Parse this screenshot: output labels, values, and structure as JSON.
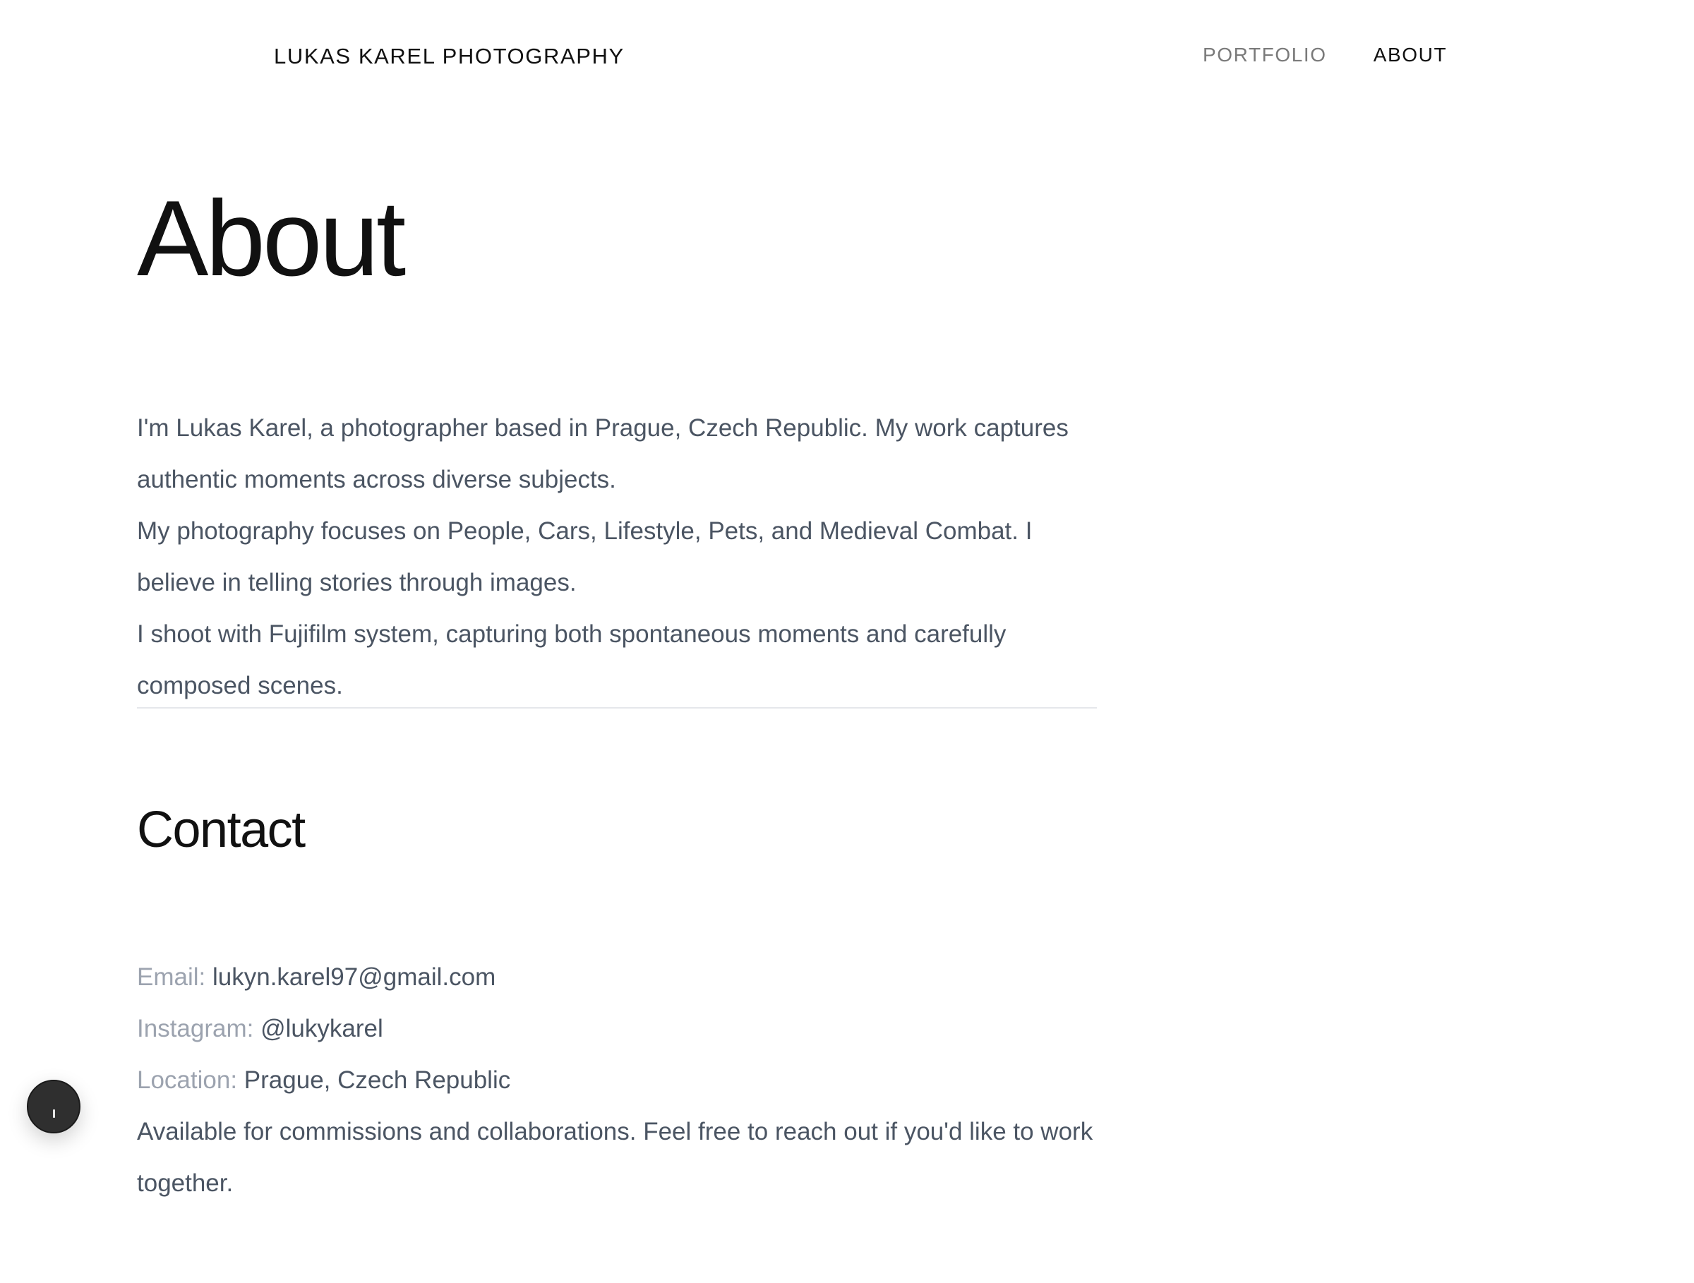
{
  "header": {
    "site_title": "LUKAS KAREL PHOTOGRAPHY",
    "nav": [
      {
        "label": "PORTFOLIO",
        "active": false
      },
      {
        "label": "ABOUT",
        "active": true
      }
    ]
  },
  "about": {
    "title": "About",
    "paragraphs": [
      "I'm Lukas Karel, a photographer based in Prague, Czech Republic. My work captures authentic moments across diverse subjects.",
      "My photography focuses on People, Cars, Lifestyle, Pets, and Medieval Combat. I believe in telling stories through images.",
      "I shoot with Fujifilm system, capturing both spontaneous moments and carefully composed scenes."
    ]
  },
  "contact": {
    "title": "Contact",
    "email_label": "Email:",
    "email_value": "lukyn.karel97@gmail.com",
    "instagram_label": "Instagram:",
    "instagram_value": "@lukykarel",
    "location_label": "Location:",
    "location_value": "Prague, Czech Republic",
    "availability": "Available for commissions and collaborations. Feel free to reach out if you'd like to work together."
  },
  "floating_button": {
    "icon": "dark-circle-button-icon"
  },
  "colors": {
    "background": "#ffffff",
    "heading": "#111111",
    "body_text": "#4b5563",
    "label_text": "#9ca3af",
    "nav_inactive": "#7a7a7a",
    "divider": "#e5e7eb",
    "fab": "#2f2f2f"
  }
}
